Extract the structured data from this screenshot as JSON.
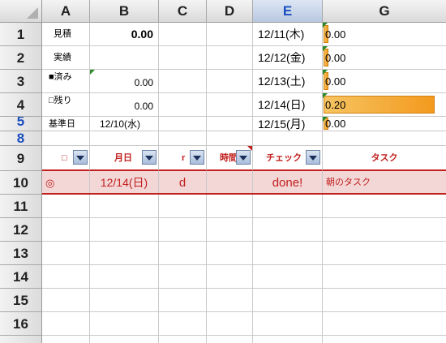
{
  "columns": [
    "A",
    "B",
    "C",
    "D",
    "E",
    "G"
  ],
  "rows": [
    "1",
    "2",
    "3",
    "4",
    "5",
    "8",
    "9",
    "10",
    "11",
    "12",
    "13",
    "14",
    "15",
    "16"
  ],
  "summary": {
    "a1": "見積",
    "b1": "0.00",
    "a2": "実績",
    "a3": "■済み",
    "b3": "0.00",
    "a4": "□残り",
    "b4": "0.00",
    "a5": "基準日",
    "b5": "12/10(水)"
  },
  "dates": [
    "12/11(木)",
    "12/12(金)",
    "12/13(土)",
    "12/14(日)",
    "12/15(月)"
  ],
  "daily_totals": [
    "0.00",
    "0.00",
    "0.00",
    "0.20",
    "0.00"
  ],
  "daily_bar_fraction": [
    0,
    0,
    0,
    0.9,
    0
  ],
  "filter_headers": {
    "a": "□",
    "b": "月日",
    "c": "r",
    "d": "時間",
    "e": "チェック",
    "g": "タスク"
  },
  "task_row": {
    "a": "◎",
    "b": "12/14(日)",
    "c": "d",
    "e": "done!",
    "g": "朝のタスク"
  },
  "colors": {
    "accent_red": "#c0201e",
    "bar_orange": "#f39a1e",
    "task_row_bg": "#f3d6d6"
  }
}
